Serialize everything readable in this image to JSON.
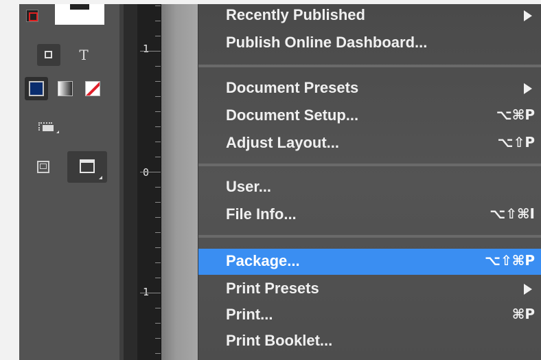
{
  "ruler": {
    "labels": [
      "1",
      "0",
      "1"
    ]
  },
  "tools": {
    "text_tool_glyph": "T"
  },
  "menu": {
    "items": [
      {
        "label": "Recently Published",
        "shortcut": "",
        "submenu": true
      },
      {
        "label": "Publish Online Dashboard...",
        "shortcut": "",
        "submenu": false
      },
      {
        "label": "Document Presets",
        "shortcut": "",
        "submenu": true
      },
      {
        "label": "Document Setup...",
        "shortcut": "⌥⌘P",
        "submenu": false
      },
      {
        "label": "Adjust Layout...",
        "shortcut": "⌥⇧P",
        "submenu": false
      },
      {
        "label": "User...",
        "shortcut": "",
        "submenu": false
      },
      {
        "label": "File Info...",
        "shortcut": "⌥⇧⌘I",
        "submenu": false
      },
      {
        "label": "Package...",
        "shortcut": "⌥⇧⌘P",
        "submenu": false,
        "highlighted": true
      },
      {
        "label": "Print Presets",
        "shortcut": "",
        "submenu": true
      },
      {
        "label": "Print...",
        "shortcut": "⌘P",
        "submenu": false
      },
      {
        "label": "Print Booklet...",
        "shortcut": "",
        "submenu": false
      }
    ]
  },
  "colors": {
    "highlight": "#3a8ef2",
    "fill_swatch": "#0a2d6e",
    "none_stroke": "#e0202a"
  }
}
